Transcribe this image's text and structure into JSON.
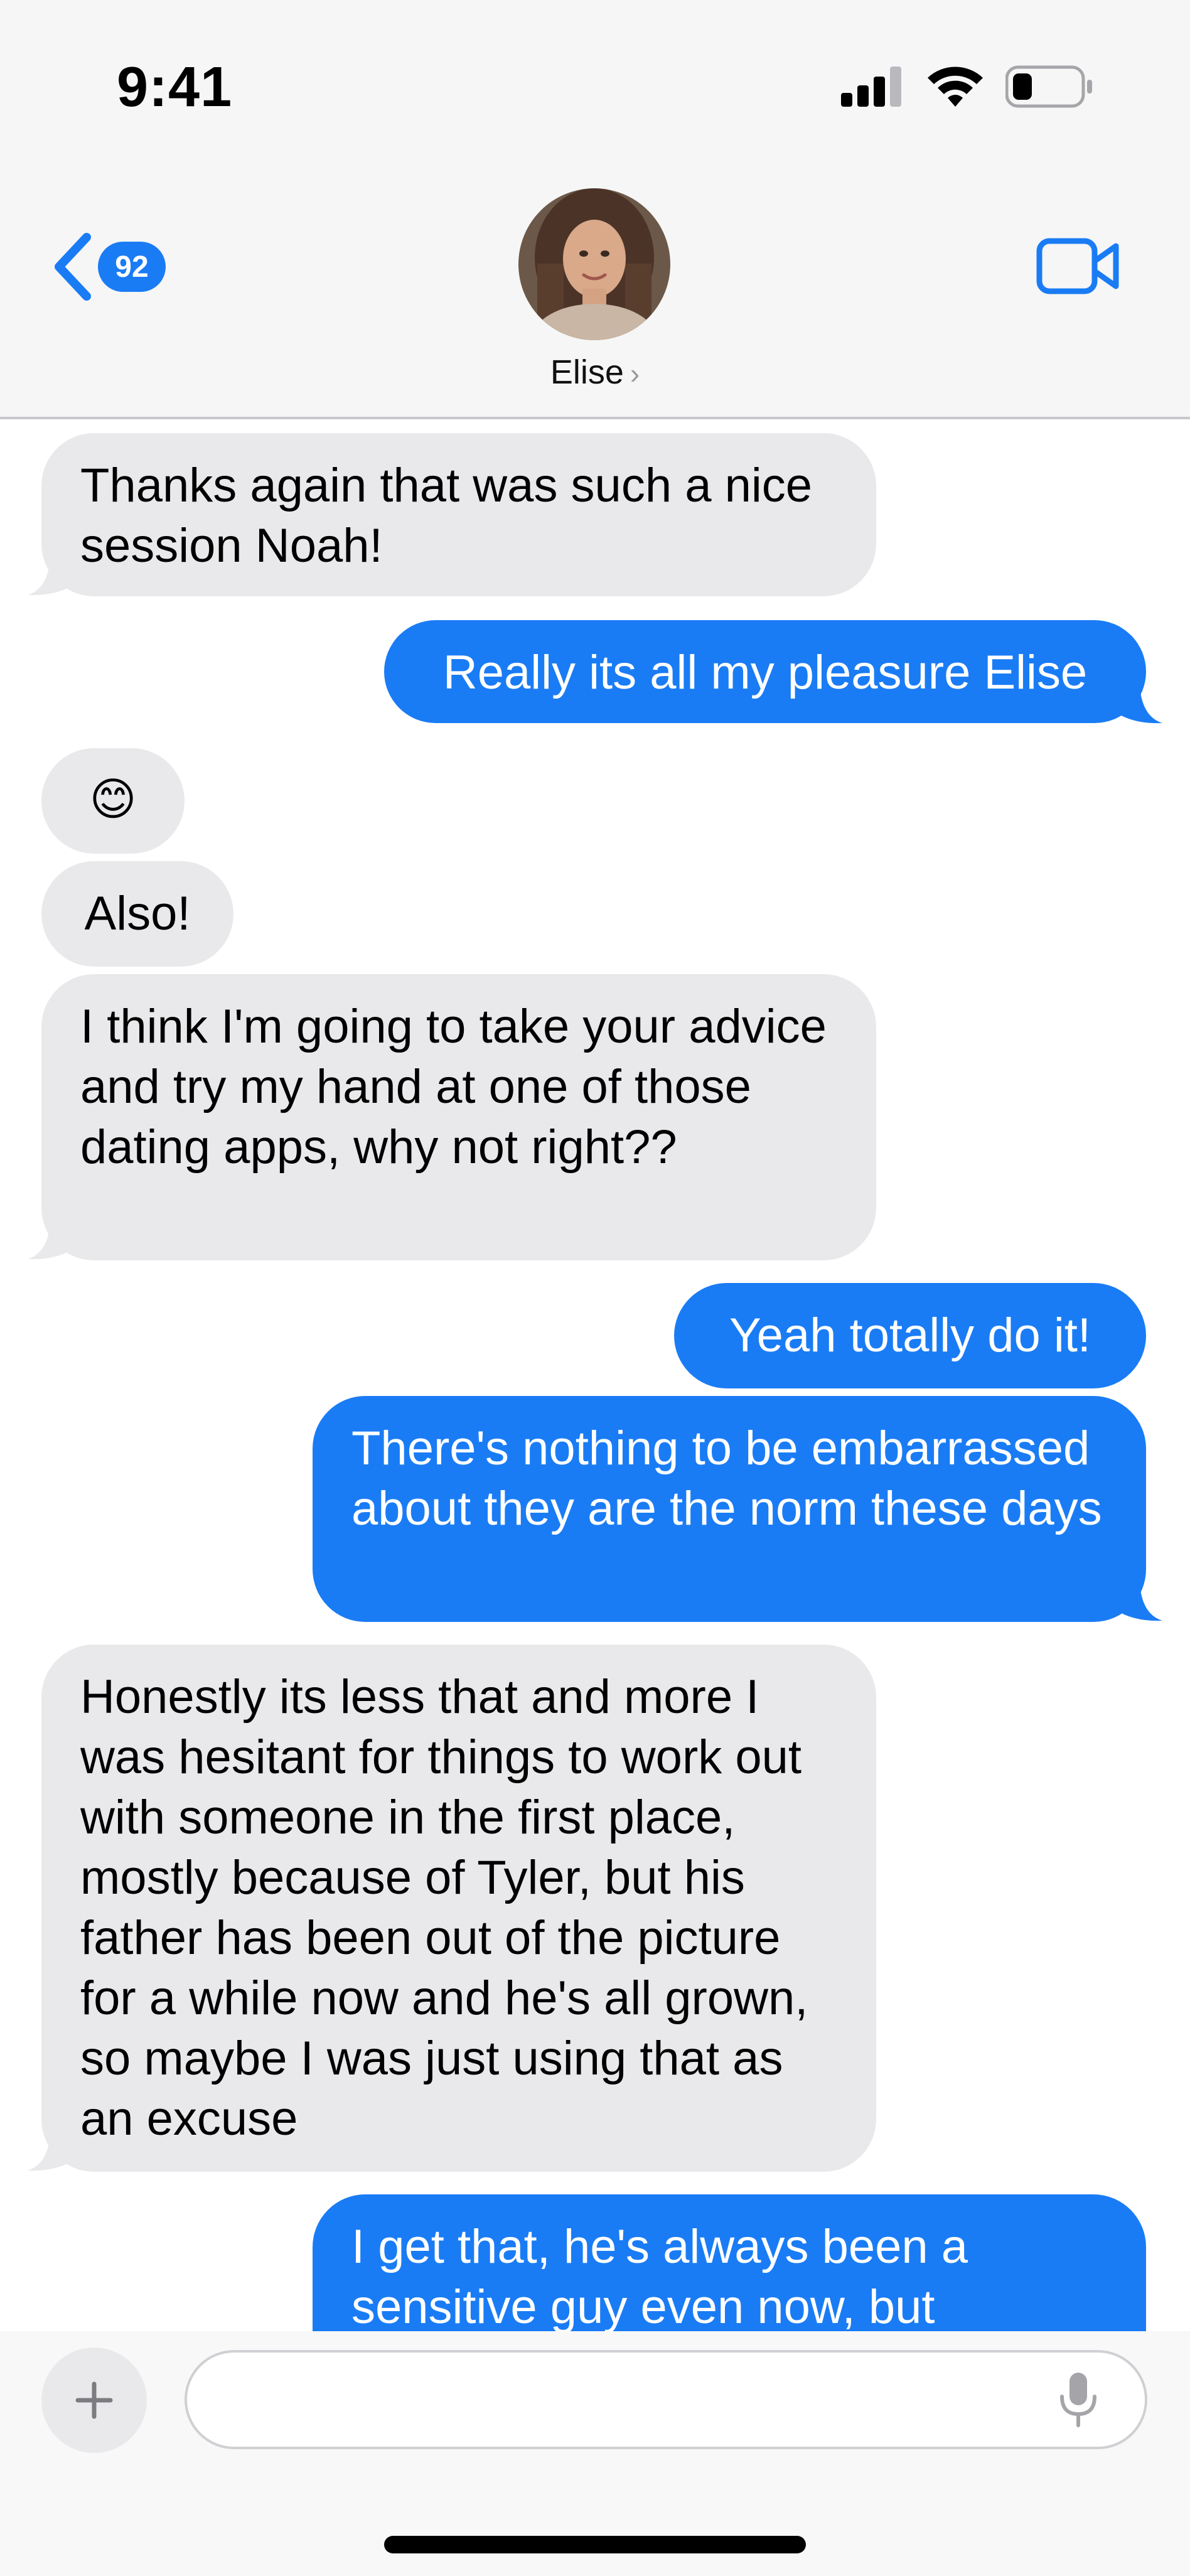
{
  "status": {
    "time": "9:41"
  },
  "header": {
    "back_count": "92",
    "contact": "Elise"
  },
  "messages": [
    {
      "from": "in",
      "text": "Thanks again that was such a nice session Noah!"
    },
    {
      "from": "out",
      "text": "Really its all my pleasure Elise"
    },
    {
      "from": "in",
      "text": "😊"
    },
    {
      "from": "in",
      "text": "Also!"
    },
    {
      "from": "in",
      "text": "I think I'm going to take your advice and try my hand at one of those dating apps, why not right??"
    },
    {
      "from": "out",
      "text": "Yeah totally do it!"
    },
    {
      "from": "out",
      "text": "There's nothing to be embarrassed about they are the norm these days"
    },
    {
      "from": "in",
      "text": "Honestly its less that and more I was hesitant for things to work out with someone in the first place, mostly because of Tyler, but his father has been out of the picture for a while now and he's all grown, so maybe I was just using that as an excuse"
    },
    {
      "from": "out",
      "text": "I get that, he's always been a sensitive guy even now, but"
    }
  ],
  "colors": {
    "accent": "#1a7cf5",
    "incoming": "#e9e9eb"
  },
  "icons": [
    "back-chevron-icon",
    "video-call-icon",
    "plus-icon",
    "microphone-icon",
    "signal-icon",
    "wifi-icon",
    "battery-icon"
  ]
}
